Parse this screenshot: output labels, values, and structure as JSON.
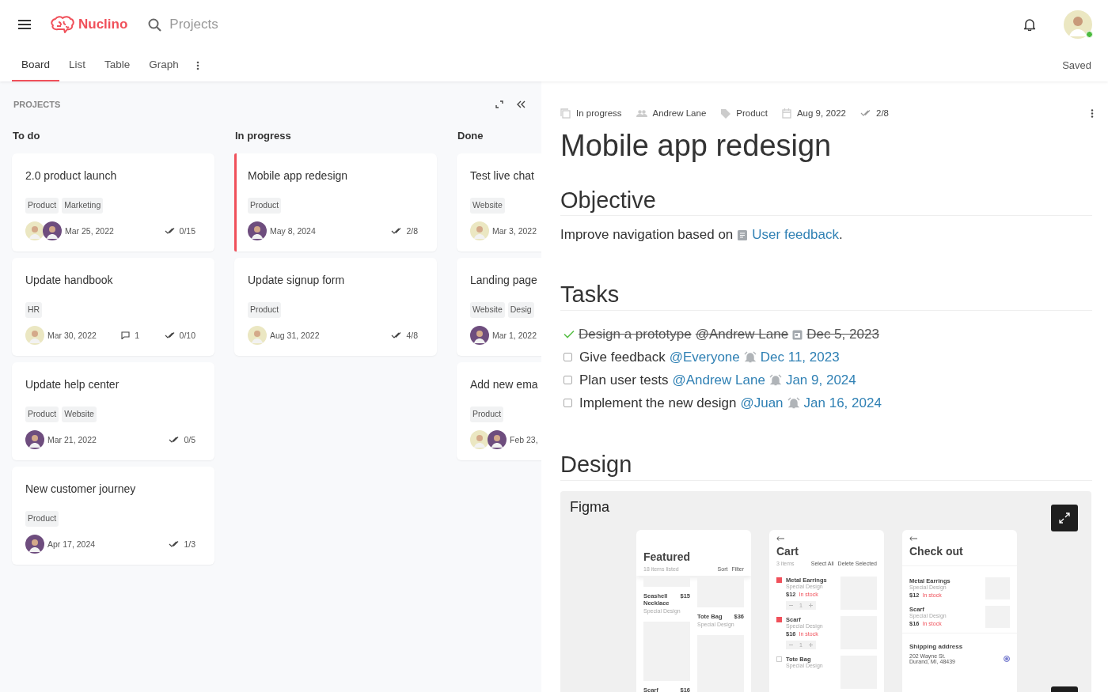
{
  "app": {
    "logo": "Nuclino",
    "search": {
      "placeholder": "Projects"
    }
  },
  "tabs": [
    {
      "label": "Board",
      "selected": true
    },
    {
      "label": "List",
      "selected": false
    },
    {
      "label": "Table",
      "selected": false
    },
    {
      "label": "Graph",
      "selected": false
    }
  ],
  "save_status": "Saved",
  "board": {
    "title": "PROJECTS",
    "columns": [
      {
        "title": "To do",
        "cards": [
          {
            "title": "2.0 product launch",
            "selected": false,
            "tags": [
              "Product",
              "Marketing"
            ],
            "avatars": [
              {
                "color": "#ebe7c2"
              },
              {
                "color": "#6e4d7e"
              }
            ],
            "date": "Mar 25, 2022",
            "tasks": "0/15"
          },
          {
            "title": "Update handbook",
            "selected": false,
            "tags": [
              "HR"
            ],
            "avatars": [
              {
                "color": "#ebe7c2"
              }
            ],
            "date": "Mar 30, 2022",
            "comments": "1",
            "tasks": "0/10"
          },
          {
            "title": "Update help center",
            "selected": false,
            "tags": [
              "Product",
              "Website"
            ],
            "avatars": [
              {
                "color": "#6e4d7e"
              }
            ],
            "date": "Mar 21, 2022",
            "tasks": "0/5"
          },
          {
            "title": "New customer journey",
            "selected": false,
            "tags": [
              "Product"
            ],
            "avatars": [
              {
                "color": "#6e4d7e"
              }
            ],
            "date": "Apr 17, 2024",
            "tasks": "1/3"
          }
        ]
      },
      {
        "title": "In progress",
        "cards": [
          {
            "title": "Mobile app redesign",
            "selected": true,
            "tags": [
              "Product"
            ],
            "avatars": [
              {
                "color": "#6e4d7e"
              }
            ],
            "date": "May 8, 2024",
            "tasks": "2/8"
          },
          {
            "title": "Update signup form",
            "selected": false,
            "tags": [
              "Product"
            ],
            "avatars": [
              {
                "color": "#ebe7c2"
              }
            ],
            "date": "Aug 31, 2022",
            "tasks": "4/8"
          }
        ]
      },
      {
        "title": "Done",
        "cards": [
          {
            "title": "Test live chat",
            "selected": false,
            "tags": [
              "Website"
            ],
            "avatars": [
              {
                "color": "#ebe7c2"
              }
            ],
            "date": "Mar 3, 2022"
          },
          {
            "title": "Landing page",
            "selected": false,
            "tags": [
              "Website",
              "Desig"
            ],
            "avatars": [
              {
                "color": "#6e4d7e"
              }
            ],
            "date": "Mar 1, 2022"
          },
          {
            "title": "Add new ema",
            "selected": false,
            "tags": [
              "Product"
            ],
            "avatars": [
              {
                "color": "#ebe7c2"
              },
              {
                "color": "#6e4d7e"
              }
            ],
            "date": "Feb 23,"
          }
        ]
      }
    ]
  },
  "document": {
    "meta": [
      {
        "kind": "status",
        "text": "In progress"
      },
      {
        "kind": "people",
        "text": "Andrew Lane"
      },
      {
        "kind": "tag",
        "text": "Product"
      },
      {
        "kind": "date",
        "text": "Aug 9, 2022"
      },
      {
        "kind": "tasks",
        "text": "2/8"
      }
    ],
    "title": "Mobile app redesign",
    "objective": {
      "heading": "Objective",
      "text": "Improve navigation based on",
      "link": "User feedback",
      "after": "."
    },
    "tasks": {
      "heading": "Tasks",
      "items": [
        {
          "text": "Design a prototype",
          "mention": "@Andrew Lane",
          "date": "Dec 5, 2023",
          "done": true
        },
        {
          "text": "Give feedback",
          "mention": "@Everyone",
          "date": "Dec 11, 2023",
          "done": false
        },
        {
          "text": "Plan user tests",
          "mention": "@Andrew Lane",
          "date": "Jan 9, 2024",
          "done": false
        },
        {
          "text": "Implement the new design",
          "mention": "@Juan",
          "date": "Jan 16, 2024",
          "done": false
        }
      ]
    },
    "design": {
      "heading": "Design",
      "embed": {
        "title": "Figma",
        "frames": [
          {
            "kind": "featured",
            "title": "Featured",
            "subtitle": "18 items listed",
            "actions": [
              "Sort",
              "Filter"
            ],
            "columns": [
              [
                {
                  "name": "Seashell Necklace",
                  "price": "$15",
                  "sub": "Special Design"
                },
                {
                  "name": "Scarf",
                  "price": "$16"
                }
              ],
              [
                {
                  "name": "Tote Bag",
                  "price": "$36",
                  "sub": "Special Design"
                }
              ]
            ]
          },
          {
            "kind": "cart",
            "title": "Cart",
            "subtitle": "3 items",
            "actions": [
              "Select All",
              "Delete Selected"
            ],
            "items": [
              {
                "name": "Metal Earrings",
                "sub": "Special Design",
                "price": "$12",
                "stock": "In stock",
                "qty": "1",
                "checked": true
              },
              {
                "name": "Scarf",
                "sub": "Special Design",
                "price": "$16",
                "stock": "In stock",
                "qty": "1",
                "checked": true
              },
              {
                "name": "Tote Bag",
                "sub": "Special Design",
                "checked": false
              }
            ]
          },
          {
            "kind": "checkout",
            "title": "Check out",
            "items": [
              {
                "name": "Metal Earrings",
                "sub": "Special Design",
                "price": "$12",
                "stock": "In stock"
              },
              {
                "name": "Scarf",
                "sub": "Special Design",
                "price": "$16",
                "stock": "In stock"
              }
            ],
            "address": {
              "heading": "Shipping address",
              "lines": [
                "202 Wayne St.",
                "Durand, MI, 48439"
              ],
              "selected": true
            }
          }
        ]
      }
    }
  }
}
